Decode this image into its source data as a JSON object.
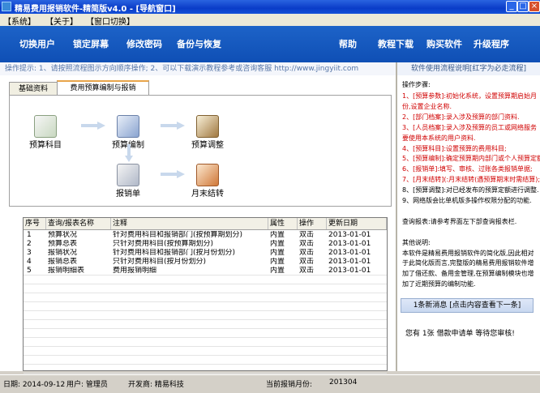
{
  "window": {
    "title": "精易费用报销软件-精简版v4.0  - [导航窗口]"
  },
  "menu": {
    "items": [
      "【系统】",
      "【关于】",
      "【窗口切换】"
    ]
  },
  "nav": {
    "left": [
      "切换用户",
      "锁定屏幕",
      "修改密码",
      "备份与恢复"
    ],
    "right": [
      "帮助",
      "教程下载",
      "购买软件",
      "升级程序"
    ]
  },
  "hint": {
    "text": "操作提示: 1、请按照流程图示方向顺序操作; 2、可以下载演示教程参考或咨询客服 http://www.jingyiit.com"
  },
  "tabs": [
    "基础资料",
    "费用预算编制与报销"
  ],
  "flow": {
    "nodes": [
      "预算科目",
      "预算编制",
      "预算调整",
      "报销单",
      "月末结转"
    ]
  },
  "table": {
    "headers": [
      "序号",
      "查询/报表名称",
      "注释",
      "属性",
      "操作",
      "更新日期"
    ],
    "rows": [
      [
        "1",
        "预算状况",
        "针对费用科目和报销部门(按预算期划分)",
        "内置",
        "双击",
        "2013-01-01"
      ],
      [
        "2",
        "预算总表",
        "只针对费用科目(按预算期划分)",
        "内置",
        "双击",
        "2013-01-01"
      ],
      [
        "3",
        "报销状况",
        "针对费用科目和报销部门(按月份划分)",
        "内置",
        "双击",
        "2013-01-01"
      ],
      [
        "4",
        "报销总表",
        "只针对费用科目(按月份划分)",
        "内置",
        "双击",
        "2013-01-01"
      ],
      [
        "5",
        "报销明细表",
        "费用报销明细",
        "内置",
        "双击",
        "2013-01-01"
      ]
    ]
  },
  "right": {
    "header": "软件使用流程说明[红字为必走流程]",
    "steps_title": "操作步骤:",
    "lines": [
      {
        "t": "1、[预算参数]:初始化系统，设置预算期启始月",
        "red": true
      },
      {
        "t": "       份,设置企业名称.",
        "red": true
      },
      {
        "t": "2、[部门档案]:录入涉及预算的部门资料.",
        "red": true
      },
      {
        "t": "3、[人员档案]:录入涉及预算的员工或网络服务",
        "red": true
      },
      {
        "t": "       要使用本系统的用户资料.",
        "red": true
      },
      {
        "t": "4、[预算科目]:设置预算的费用科目;",
        "red": true
      },
      {
        "t": "5、[预算编制]:确定预算期内部门或个人预算定额",
        "red": true
      },
      {
        "t": "6、[报销单]:填写、审核、过账各类报销单据;",
        "red": true
      },
      {
        "t": "7、[月末结转](:月末结转(遇预算期末时需结算);",
        "red": true
      },
      {
        "t": "8、[预算调整]:对已经发布的预算定额进行调整.",
        "red": false
      },
      {
        "t": "9、网络版会比单机版多操作权限分配的功能.",
        "red": false
      },
      {
        "t": "",
        "red": false
      },
      {
        "t": "查询报表:请参考界面左下部查询报表栏.",
        "red": false
      },
      {
        "t": "",
        "red": false
      },
      {
        "t": "其他说明:",
        "red": false
      },
      {
        "t": "本软件是精易费用报销软件的简化版,因此相对",
        "red": false
      },
      {
        "t": "于此简化版而言,完整版的精易费用报销软件增",
        "red": false
      },
      {
        "t": "加了借还款、备用金管理,在预算编制模块也增",
        "red": false
      },
      {
        "t": "加了近期预算的编制功能.",
        "red": false
      }
    ],
    "notice": "1条新消息 [点击内容查看下一条]",
    "message": "您有 1张 借款申请单 等待您审核!"
  },
  "status": {
    "date": "日期: 2014-09-12",
    "user": "用户: 管理员",
    "dev": "开发商: 精易科技",
    "period_label": "当前报销月份:",
    "period": "201304"
  }
}
